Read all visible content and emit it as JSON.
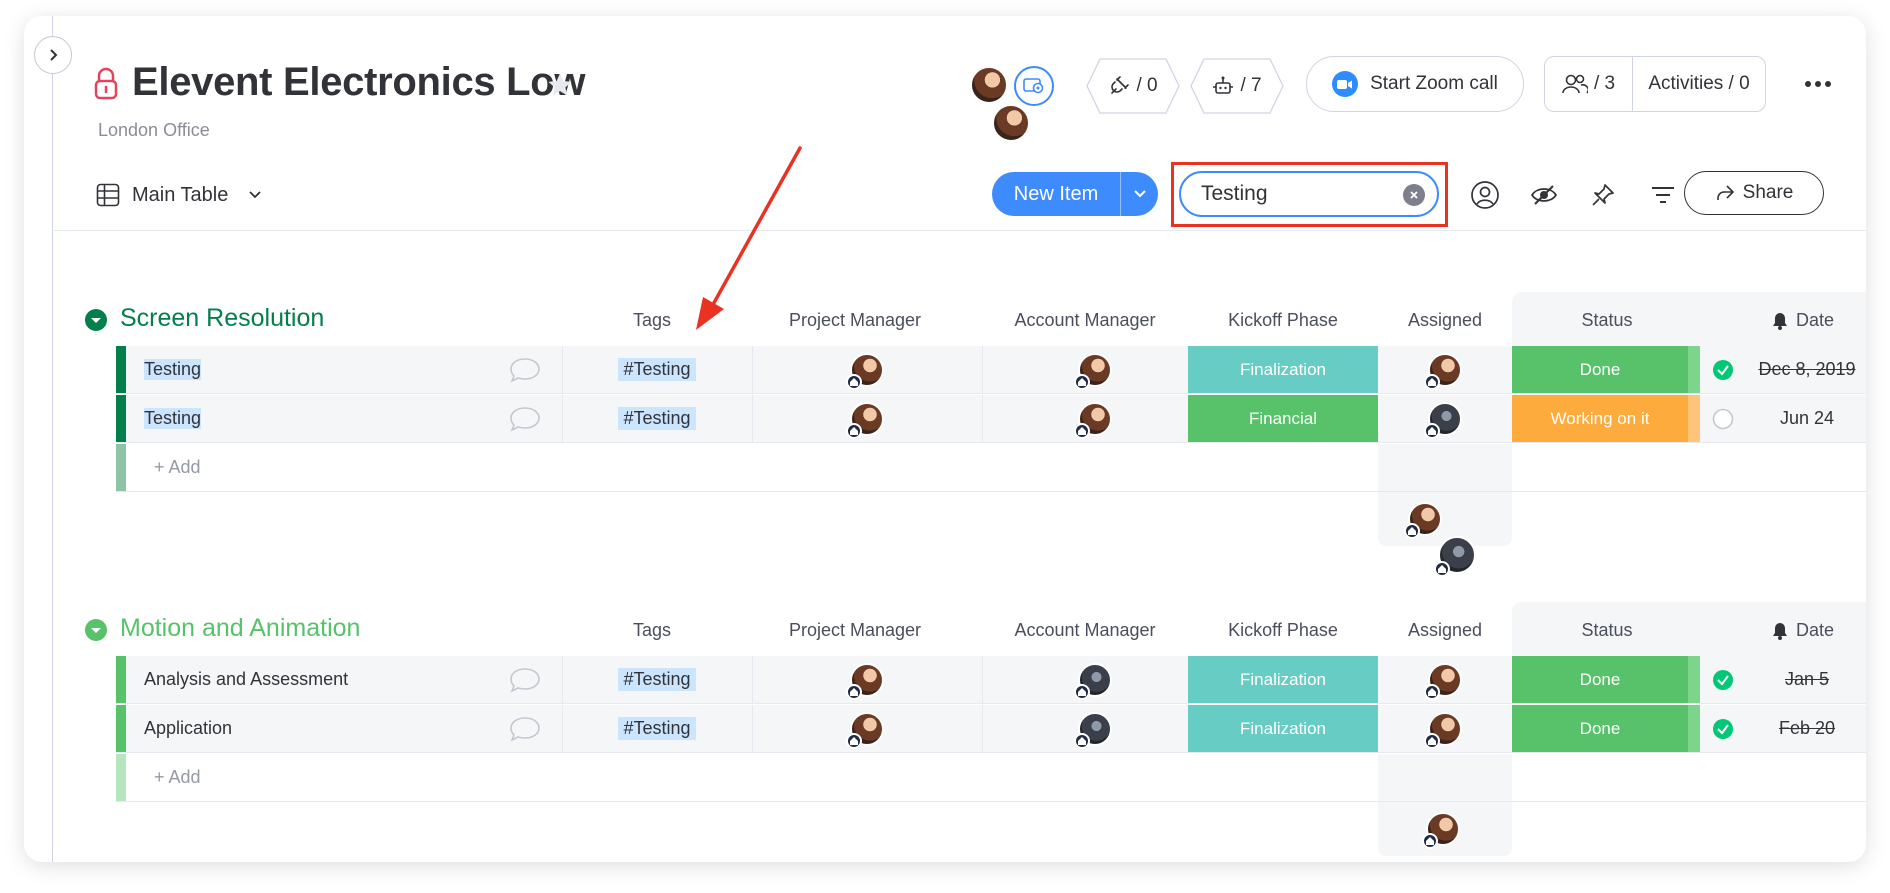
{
  "board": {
    "title": "Elevent Electronics Low",
    "subtitle": "London Office"
  },
  "header": {
    "integrations_count": "/ 0",
    "automations_count": "/ 7",
    "zoom_label": "Start Zoom call",
    "members_count": "/ 3",
    "activities_label": "Activities / 0"
  },
  "toolbar": {
    "view_label": "Main Table",
    "new_item_label": "New Item",
    "search_value": "Testing",
    "share_label": "Share"
  },
  "columns": {
    "tags": "Tags",
    "project_manager": "Project Manager",
    "account_manager": "Account Manager",
    "kickoff_phase": "Kickoff Phase",
    "assigned": "Assigned",
    "status": "Status",
    "date": "Date"
  },
  "groups": [
    {
      "title": "Screen Resolution",
      "color": "#037f4c",
      "add_label": "+ Add",
      "rows": [
        {
          "name": "Testing",
          "tag": "#Testing",
          "phase": "Finalization",
          "phase_color": "#66ccc4",
          "status": "Done",
          "status_color": "#57c26a",
          "checked": true,
          "date": "Dec 8, 2019",
          "date_done": true
        },
        {
          "name": "Testing",
          "tag": "#Testing",
          "phase": "Financial",
          "phase_color": "#57c26a",
          "status": "Working on it",
          "status_color": "#fdab3d",
          "checked": false,
          "date": "Jun 24",
          "date_done": false
        }
      ]
    },
    {
      "title": "Motion and Animation",
      "color": "#57c26a",
      "add_label": "+ Add",
      "rows": [
        {
          "name": "Analysis and Assessment",
          "tag": "#Testing",
          "phase": "Finalization",
          "phase_color": "#66ccc4",
          "status": "Done",
          "status_color": "#57c26a",
          "checked": true,
          "date": "Jan 5",
          "date_done": true
        },
        {
          "name": "Application",
          "tag": "#Testing",
          "phase": "Finalization",
          "phase_color": "#66ccc4",
          "status": "Done",
          "status_color": "#57c26a",
          "checked": true,
          "date": "Feb 20",
          "date_done": true
        }
      ]
    }
  ],
  "colors": {
    "primary": "#3d8bfd",
    "highlight_box": "#e83323",
    "annotation_arrow": "#e83323"
  }
}
